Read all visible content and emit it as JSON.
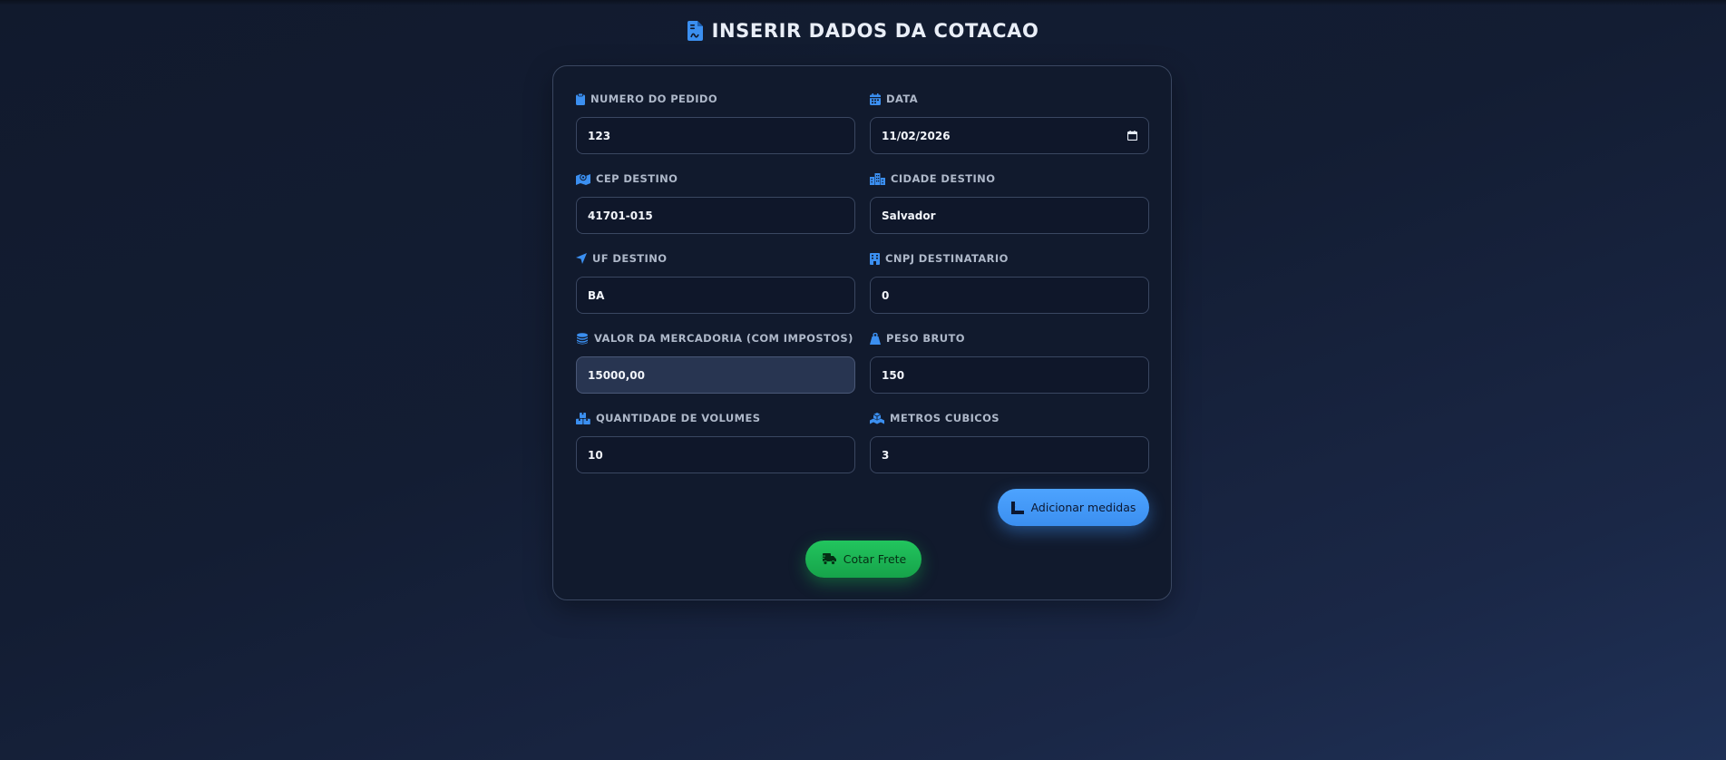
{
  "header": {
    "title": "INSERIR DADOS DA COTACAO",
    "icon": "file-invoice-icon"
  },
  "colors": {
    "accent": "#3b8ff0",
    "success": "#16a34a",
    "card_bg": "#111a2d",
    "input_bg": "#0f172a",
    "label": "#aeb8c9"
  },
  "form": {
    "numero_pedido": {
      "label": "NUMERO DO PEDIDO",
      "value": "123",
      "icon": "clipboard-icon"
    },
    "data": {
      "label": "DATA",
      "value": "11/02/2026",
      "icon": "calendar-icon"
    },
    "cep_destino": {
      "label": "CEP DESTINO",
      "value": "41701-015",
      "icon": "map-location-icon"
    },
    "cidade_destino": {
      "label": "CIDADE DESTINO",
      "value": "Salvador",
      "icon": "city-icon"
    },
    "uf_destino": {
      "label": "UF DESTINO",
      "value": "BA",
      "icon": "location-arrow-icon"
    },
    "cnpj_destinatario": {
      "label": "CNPJ DESTINATARIO",
      "value": "0",
      "icon": "building-icon"
    },
    "valor_mercadoria": {
      "label": "VALOR DA MERCADORIA (COM IMPOSTOS)",
      "value": "15000,00",
      "icon": "coins-icon"
    },
    "peso_bruto": {
      "label": "PESO BRUTO",
      "value": "150",
      "icon": "weight-icon"
    },
    "quantidade_volumes": {
      "label": "QUANTIDADE DE VOLUMES",
      "value": "10",
      "icon": "boxes-icon"
    },
    "metros_cubicos": {
      "label": "METROS CUBICOS",
      "value": "3",
      "icon": "cubes-icon"
    }
  },
  "buttons": {
    "adicionar_medidas": "Adicionar medidas",
    "cotar_frete": "Cotar Frete"
  }
}
